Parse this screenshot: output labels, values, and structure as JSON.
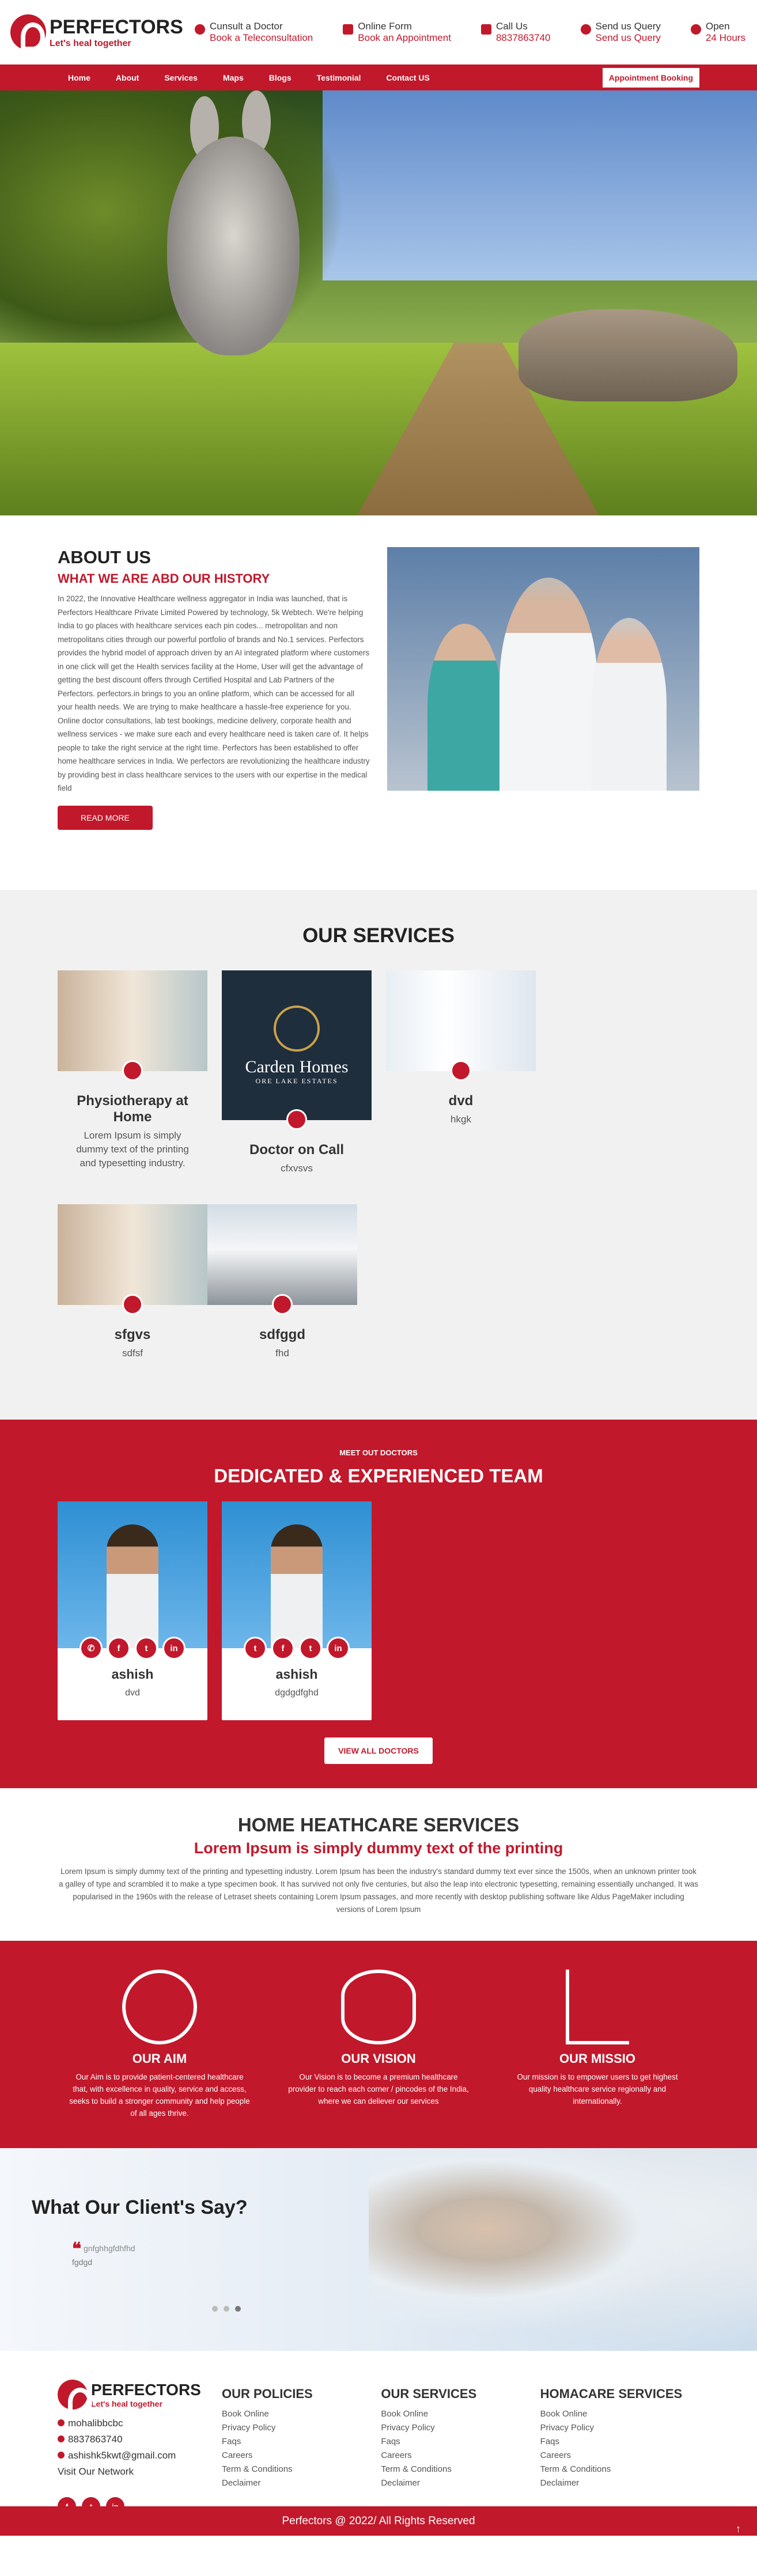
{
  "header": {
    "logo_title": "PERFECTORS",
    "logo_tagline": "Let's heal together",
    "contacts": [
      {
        "icon": "phone-icon",
        "label": "Cunsult a Doctor",
        "value": "Book a Teleconsultation"
      },
      {
        "icon": "mail-icon",
        "label": "Online Form",
        "value": "Book an Appointment"
      },
      {
        "icon": "mobile-icon",
        "label": "Call Us",
        "value": "8837863740"
      },
      {
        "icon": "location-icon",
        "label": "Send us Query",
        "value": "Send us Query"
      },
      {
        "icon": "clock-icon",
        "label": "Open",
        "value": "24 Hours"
      }
    ]
  },
  "nav": {
    "items": [
      "Home",
      "About",
      "Services",
      "Maps",
      "Blogs",
      "Testimonial",
      "Contact US"
    ],
    "cta": "Appointment Booking"
  },
  "about": {
    "title": "ABOUT US",
    "subtitle": "WHAT WE ARE ABD OUR HISTORY",
    "body": "In 2022, the Innovative Healthcare wellness aggregator in India was launched, that is Perfectors Healthcare Private Limited Powered by technology, 5k Webtech. We're helping India to go places with healthcare services each pin codes... metropolitan and non metropolitans cities through our powerful portfolio of brands and No.1 services. Perfectors provides the hybrid model of approach driven by an AI integrated platform where customers in one click will get the Health services facility at the Home, User will get the advantage of getting the best discount offers through Certified Hospital and Lab Partners of the Perfectors. perfectors.in brings to you an online platform, which can be accessed for all your health needs. We are trying to make healthcare a hassle-free experience for you. Online doctor consultations, lab test bookings, medicine delivery, corporate health and wellness services - we make sure each and every healthcare need is taken care of. It helps people to take the right service at the right time. Perfectors has been established to offer home healthcare services in India. We perfectors are revolutionizing the healthcare industry by providing best in class healthcare services to the users with our expertise in the medical field",
    "button": "READ MORE"
  },
  "services": {
    "title": "OUR SERVICES",
    "items": [
      {
        "name": "Physiotherapy at Home",
        "desc": "Lorem Ipsum is simply dummy text of the printing and typesetting industry.",
        "icon": "ambulance-icon"
      },
      {
        "name": "Doctor on Call",
        "desc": "cfxvsvs",
        "icon": "truck-icon",
        "logo_text": "Carden Homes",
        "logo_sub": "ORE LAKE ESTATES"
      },
      {
        "name": "dvd",
        "desc": "hkgk",
        "icon": "facebook-icon"
      },
      {
        "name": "sfgvs",
        "desc": "sdfsf",
        "icon": "user-icon"
      },
      {
        "name": "sdfggd",
        "desc": "fhd",
        "icon": "home-icon"
      }
    ]
  },
  "team": {
    "eyebrow": "MEET OUT DOCTORS",
    "title": "DEDICATED & EXPERIENCED TEAM",
    "members": [
      {
        "name": "ashish",
        "role": "dvd",
        "socials": [
          "✆",
          "f",
          "t",
          "in"
        ]
      },
      {
        "name": "ashish",
        "role": "dgdgdfghd",
        "socials": [
          "t",
          "f",
          "t",
          "in"
        ]
      }
    ],
    "button": "VIEW ALL DOCTORS"
  },
  "home_healthcare": {
    "title": "HOME HEATHCARE SERVICES",
    "subtitle": "Lorem Ipsum is simply dummy text of the printing",
    "body": "Lorem Ipsum is simply dummy text of the printing and typesetting industry. Lorem Ipsum has been the industry's standard dummy text ever since the 1500s, when an unknown printer took a galley of type and scrambled it to make a type specimen book. It has survived not only five centuries, but also the leap into electronic typesetting, remaining essentially unchanged. It was popularised in the 1960s with the release of Letraset sheets containing Lorem Ipsum passages, and more recently with desktop publishing software like Aldus PageMaker including versions of Lorem Ipsum"
  },
  "mission": [
    {
      "title": "OUR AIM",
      "icon": "target-icon",
      "text": "Our Aim is to provide patient-centered healthcare that, with excellence in quality, service and access, seeks to build a stronger community and help people of all ages thrive."
    },
    {
      "title": "OUR VISION",
      "icon": "eye-icon",
      "text": "Our Vision is to become a premium healthcare provider to reach each corner / pincodes of the India, where we can deliever our services"
    },
    {
      "title": "OUR MISSIO",
      "icon": "flag-climber-icon",
      "text": "Our mission is to empower users to get highest quality healthcare service regionally and internationally."
    }
  ],
  "testimonials": {
    "title": "What Our Client's Say?",
    "quote": "gnfghhgfdhfhd",
    "author": "fgdgd",
    "active_dot": 3,
    "dot_count": 3
  },
  "footer": {
    "logo_title": "PERFECTORS",
    "logo_tagline": "Let's heal together",
    "address": "mohalibbcbc",
    "phone": "8837863740",
    "email": "ashishk5kwt@gmail.com",
    "visit": "Visit Our Network",
    "socials": [
      "f",
      "t",
      "in"
    ],
    "columns": [
      {
        "title": "OUR POLICIES",
        "links": [
          "Book Online",
          "Privacy Policy",
          "Faqs",
          "Careers",
          "Term & Conditions",
          "Declaimer"
        ]
      },
      {
        "title": "OUR SERVICES",
        "links": [
          "Book Online",
          "Privacy Policy",
          "Faqs",
          "Careers",
          "Term & Conditions",
          "Declaimer"
        ]
      },
      {
        "title": "HOMACARE SERVICES",
        "links": [
          "Book Online",
          "Privacy Policy",
          "Faqs",
          "Careers",
          "Term & Conditions",
          "Declaimer"
        ]
      }
    ],
    "copyright": "Perfectors @ 2022/ All Rights Reserved"
  },
  "colors": {
    "brand": "#c2182b"
  }
}
